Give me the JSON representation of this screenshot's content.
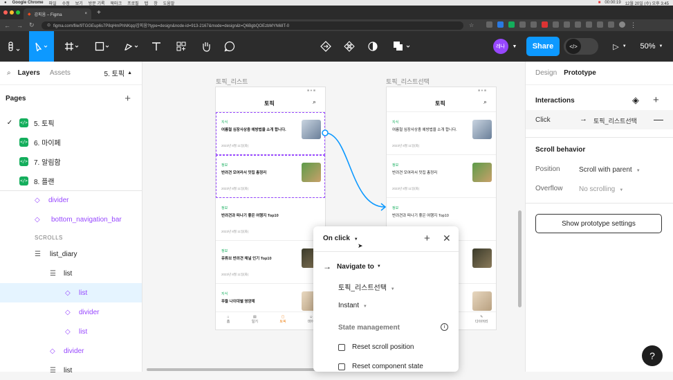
{
  "macbar": {
    "items": [
      "Google Chrome",
      "파일",
      "수정",
      "보기",
      "방문 기록",
      "북마크",
      "프로필",
      "탭",
      "창",
      "도움말"
    ],
    "time": "00:00:19",
    "clock": "12월 20일 (수) 오후 3:45"
  },
  "tabs": [
    {
      "label": "감피움 – Figma"
    }
  ],
  "address": {
    "url": "figma.com/file/9TGGEup6s7P8qHmPhNKqq/감피움?type=design&node-id=913-2167&mode=design&t=Q6BgbQOEzbMYN68T-0"
  },
  "toolbar": {
    "share": "Share",
    "avatar": "레나",
    "zoom": "50%"
  },
  "left": {
    "tab_layers": "Layers",
    "tab_assets": "Assets",
    "page_selector": "5. 토픽",
    "pages_title": "Pages",
    "pages": [
      {
        "badge": "</>",
        "name": "5. 토픽",
        "checked": true
      },
      {
        "badge": "</>",
        "name": "6. 마이페"
      },
      {
        "badge": "</>",
        "name": "7. 알림함"
      },
      {
        "badge": "</>",
        "name": "8. 플랜"
      }
    ],
    "layers": [
      {
        "name": "divider",
        "kind": "component"
      },
      {
        "name": "bottom_navigation_bar",
        "kind": "component"
      },
      {
        "name": "SCROLLS",
        "kind": "section"
      },
      {
        "name": "list_diary",
        "kind": "frame"
      },
      {
        "name": "list",
        "kind": "frame"
      },
      {
        "name": "list",
        "kind": "component",
        "selected": true
      },
      {
        "name": "divider",
        "kind": "component"
      },
      {
        "name": "list",
        "kind": "component"
      },
      {
        "name": "divider",
        "kind": "component"
      },
      {
        "name": "list",
        "kind": "frame"
      }
    ]
  },
  "canvas": {
    "frame1": {
      "label": "토픽_리스트",
      "title": "토픽"
    },
    "frame2": {
      "label": "토픽_리스트선택",
      "title": "토픽"
    },
    "cards": [
      {
        "tag": "지식",
        "title": "여름철 심장사상충 예방법을 소개 합니다.",
        "date": "2023년 8월 11일(화)"
      },
      {
        "tag": "정보",
        "title": "반려견 모여라서 맛집 총정리",
        "date": "2023년 8월 11일(화)"
      },
      {
        "tag": "정보",
        "title": "반려견과 떠나기 좋은 여행지 Top10",
        "date": "2023년 8월 11일(화)"
      },
      {
        "tag": "정보",
        "title": "유튜브 반려견 채널 인기 Top10",
        "date": "2023년 8월 11일(화)"
      },
      {
        "tag": "지식",
        "title": "푸들 나이대별 영양제",
        "date": ""
      }
    ],
    "nav": [
      "홈",
      "일기",
      "토픽",
      "마이"
    ],
    "nav2_last": "다이어리"
  },
  "popup": {
    "trigger": "On click",
    "action": "Navigate to",
    "destination": "토픽_리스트선택",
    "animation": "Instant",
    "state_title": "State management",
    "reset_scroll": "Reset scroll position",
    "reset_component": "Reset component state"
  },
  "right": {
    "tab_design": "Design",
    "tab_prototype": "Prototype",
    "interactions": "Interactions",
    "click": "Click",
    "click_target": "토픽_리스트선택",
    "scroll_behavior": "Scroll behavior",
    "position_label": "Position",
    "position_value": "Scroll with parent",
    "overflow_label": "Overflow",
    "overflow_value": "No scrolling",
    "settings_button": "Show prototype settings",
    "help": "?"
  },
  "colors": {
    "accent": "#0d99ff",
    "purple": "#9747ff",
    "green": "#14ae5c"
  }
}
